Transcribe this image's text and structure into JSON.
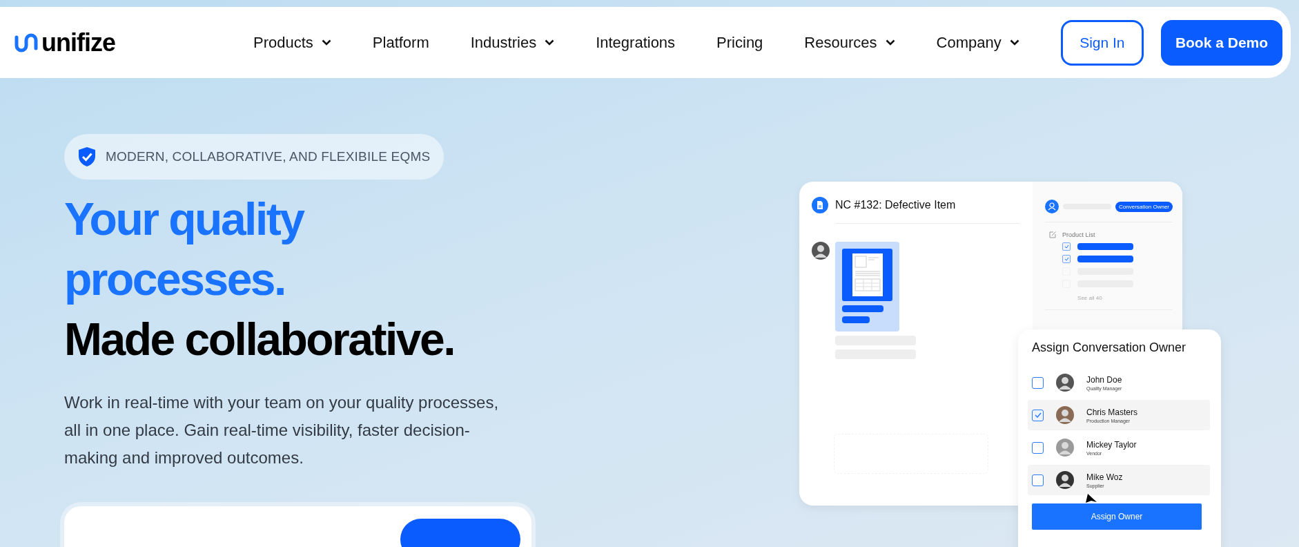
{
  "nav": {
    "logo": "unifize",
    "items": [
      {
        "label": "Products",
        "dropdown": true
      },
      {
        "label": "Platform",
        "dropdown": false
      },
      {
        "label": "Industries",
        "dropdown": true
      },
      {
        "label": "Integrations",
        "dropdown": false
      },
      {
        "label": "Pricing",
        "dropdown": false
      },
      {
        "label": "Resources",
        "dropdown": true
      },
      {
        "label": "Company",
        "dropdown": true
      }
    ],
    "sign_in": "Sign In",
    "cta": "Book a Demo"
  },
  "hero": {
    "badge": "MODERN, COLLABORATIVE, AND FLEXIBILE EQMS",
    "heading_accent": [
      "Your quality",
      "processes."
    ],
    "heading_main": "Made collaborative.",
    "description": "Work in real-time with your team on your quality processes, all in one place. Gain real-time visibility, faster decision-making and improved outcomes."
  },
  "mockup": {
    "title": "NC #132: Defective Item",
    "owner_tag": "Conversation Owner",
    "list_title": "Product List",
    "list_items": [
      {
        "checked": true
      },
      {
        "checked": true
      },
      {
        "checked": false
      },
      {
        "checked": false
      }
    ],
    "see_all": "See all 40",
    "popup": {
      "title": "Assign Conversation Owner",
      "people": [
        {
          "name": "John Doe",
          "role": "Quality Manager",
          "checked": false
        },
        {
          "name": "Chris Masters",
          "role": "Production Manager",
          "checked": true
        },
        {
          "name": "Mickey Taylor",
          "role": "Vendor",
          "checked": false
        },
        {
          "name": "Mike Woz",
          "role": "Supplier",
          "checked": false
        }
      ],
      "button": "Assign Owner"
    }
  }
}
